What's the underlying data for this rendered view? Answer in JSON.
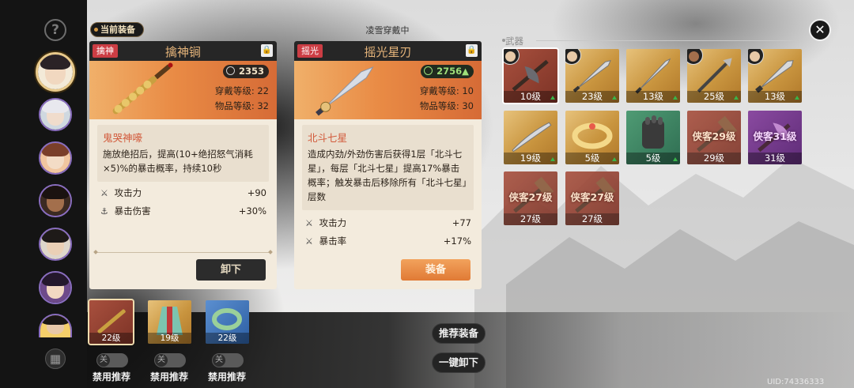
{
  "app": {
    "uid": "UID:74336333"
  },
  "sidebar": {
    "help_icon": "?",
    "menu_icon": "grid-icon"
  },
  "current_equip_tag": "当前装备",
  "equipped_by_label": "凌雪穿戴中",
  "left_card": {
    "category": "擒神",
    "name": "擒神锏",
    "score": "2353",
    "wear_level": "穿戴等级: 22",
    "item_level": "物品等级: 32",
    "skill_title": "鬼哭神嚎",
    "skill_desc": "施放绝招后，提高(10+绝招怒气消耗×5)%的暴击概率，持续10秒",
    "stats": [
      {
        "label": "攻击力",
        "value": "+90"
      },
      {
        "label": "暴击伤害",
        "value": "+30%"
      }
    ],
    "button": "卸下"
  },
  "right_card": {
    "category": "摇光",
    "name": "摇光星刃",
    "score": "2756",
    "score_arrow": "▲",
    "wear_level": "穿戴等级: 10",
    "item_level": "物品等级: 30",
    "skill_title": "北斗七星",
    "skill_desc": "造成内劲/外劲伤害后获得1层「北斗七星」，每层「北斗七星」提高17%暴击概率；触发暴击后移除所有「北斗七星」层数",
    "stats": [
      {
        "label": "攻击力",
        "value": "+77"
      },
      {
        "label": "暴击率",
        "value": "+17%"
      }
    ],
    "button": "装备"
  },
  "weapons": {
    "label": "武器",
    "items": [
      {
        "level": "10级",
        "color": "red"
      },
      {
        "level": "23级",
        "color": "gold"
      },
      {
        "level": "13级",
        "color": "gold"
      },
      {
        "level": "25级",
        "color": "gold"
      },
      {
        "level": "13级",
        "color": "gold"
      },
      {
        "level": "19级",
        "color": "gold"
      },
      {
        "level": "5级",
        "color": "gold"
      },
      {
        "level": "5级",
        "color": "green"
      },
      {
        "level": "29级",
        "color": "red",
        "overlay": "侠客29级"
      },
      {
        "level": "31级",
        "color": "purple",
        "overlay": "侠客31级"
      },
      {
        "level": "27级",
        "color": "red",
        "overlay": "侠客27级"
      },
      {
        "level": "27级",
        "color": "red",
        "overlay": "侠客27级"
      }
    ]
  },
  "equipped_slots": [
    {
      "level": "22级",
      "toggle_label": "禁用推荐",
      "toggle_state": "关"
    },
    {
      "level": "19级",
      "toggle_label": "禁用推荐",
      "toggle_state": "关"
    },
    {
      "level": "22级",
      "toggle_label": "禁用推荐",
      "toggle_state": "关"
    }
  ],
  "actions": {
    "recommend": "推荐装备",
    "unequip_all": "一键卸下"
  },
  "colors": {
    "accent": "#e07a35",
    "category_red": "#cc3d44",
    "score_green": "#9fe07a"
  }
}
